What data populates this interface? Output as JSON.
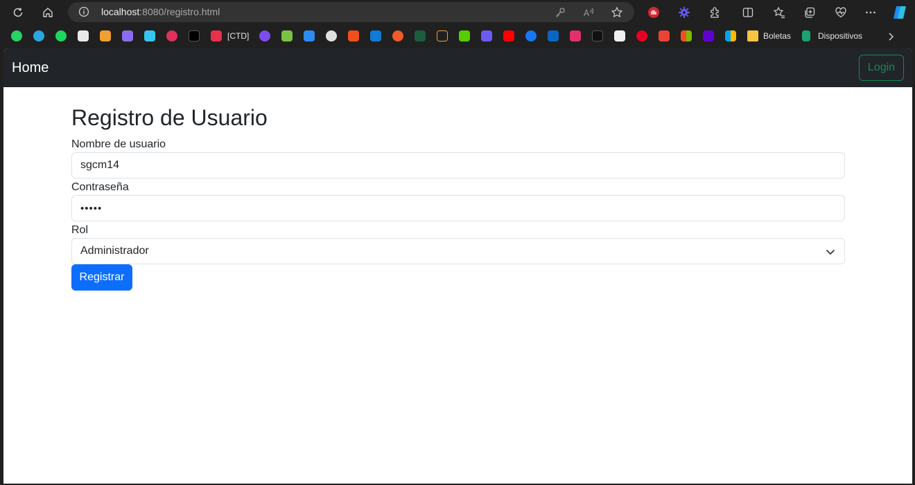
{
  "browser": {
    "url_host": "localhost",
    "url_path": ":8080/registro.html",
    "bookmarks": {
      "ctd_label": "[CTD]",
      "folder1_label": "Boletas",
      "folder2_label": "Dispositivos"
    }
  },
  "navbar": {
    "brand": "Home",
    "login_label": "Login"
  },
  "form": {
    "title": "Registro de Usuario",
    "username_label": "Nombre de usuario",
    "username_value": "sgcm14",
    "password_label": "Contraseña",
    "password_value": "•••••",
    "role_label": "Rol",
    "role_value": "Administrador",
    "submit_label": "Registrar"
  },
  "colors": {
    "navbar_bg": "#212529",
    "login_outline": "#198754",
    "primary": "#0d6efd"
  }
}
